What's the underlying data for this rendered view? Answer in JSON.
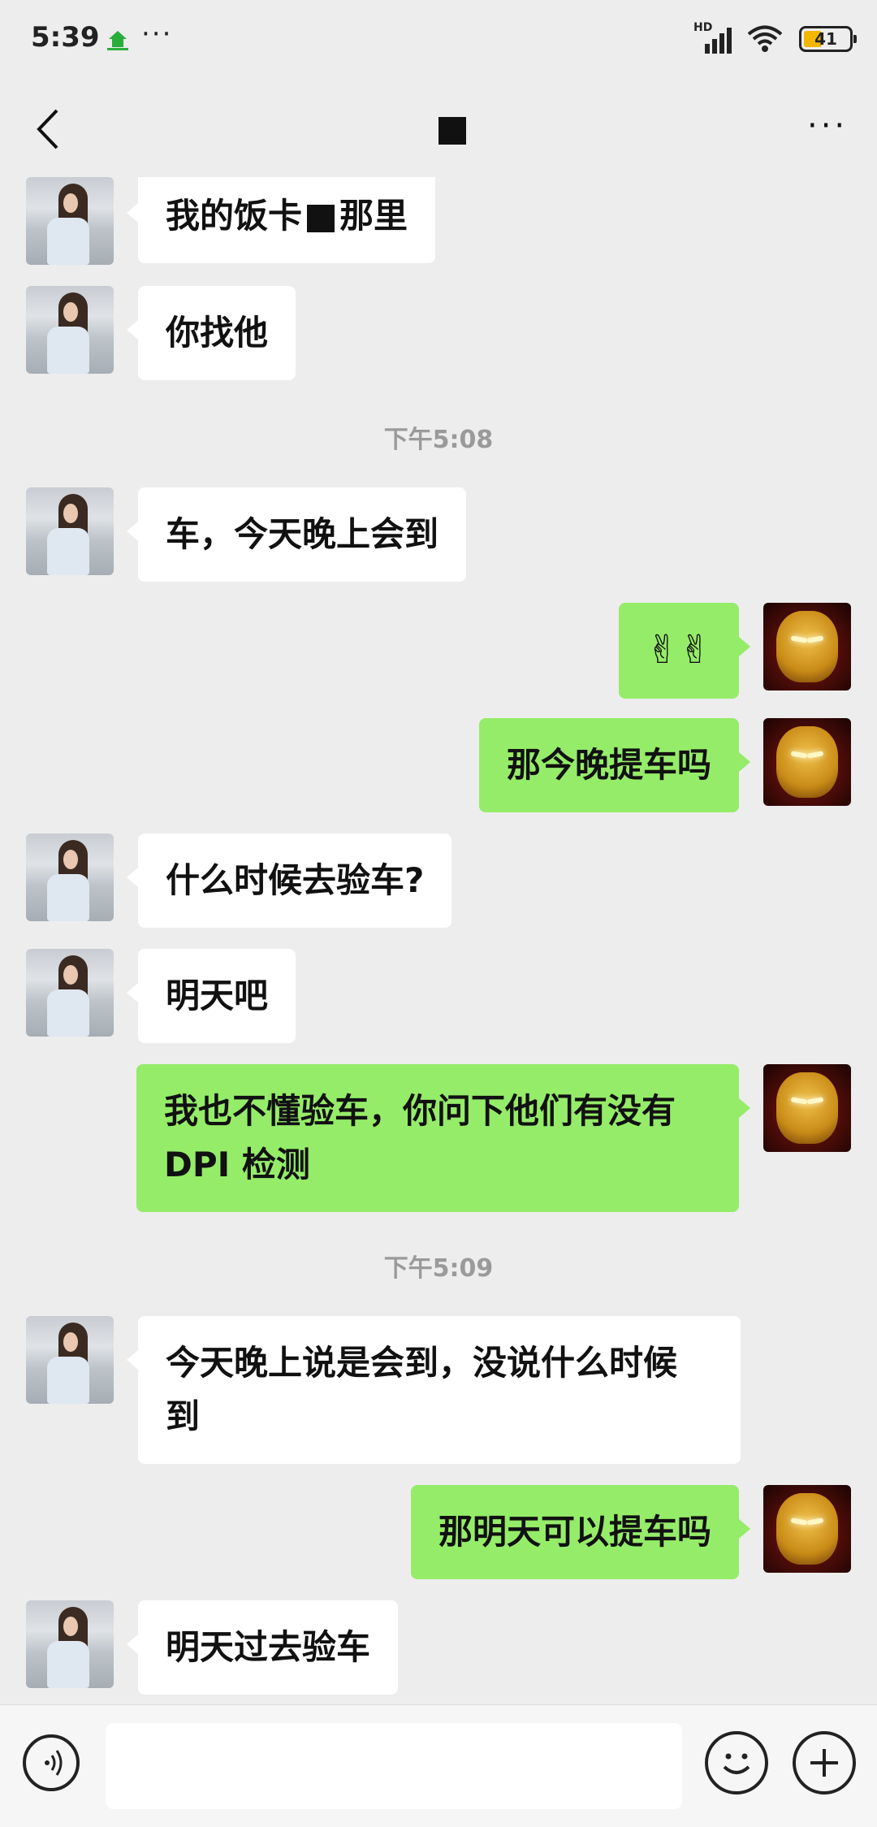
{
  "status_bar": {
    "time": "5:39",
    "dots": "···",
    "network_label": "HD",
    "battery": "41",
    "battery_level_percent": 41,
    "icons": [
      "app-icon",
      "signal-icon",
      "wifi-icon",
      "battery-icon"
    ]
  },
  "nav": {
    "back_icon": "back-chevron-icon",
    "more_icon": "more-icon",
    "more_label": "···"
  },
  "messages": [
    {
      "side": "left",
      "parts": [
        "我的饭卡",
        "[redacted]",
        "那里"
      ]
    },
    {
      "side": "left",
      "text": "你找他"
    },
    {
      "type": "time",
      "text": "下午5:08"
    },
    {
      "side": "left",
      "text": "车，今天晚上会到"
    },
    {
      "side": "right",
      "text": "✌✌"
    },
    {
      "side": "right",
      "text": "那今晚提车吗"
    },
    {
      "side": "left",
      "text": "什么时候去验车?"
    },
    {
      "side": "left",
      "text": "明天吧"
    },
    {
      "side": "right",
      "line1": "我也不懂验车，你问下他们有没有",
      "line2": "DPI 检测"
    },
    {
      "type": "time",
      "text": "下午5:09"
    },
    {
      "side": "left",
      "line1": "今天晚上说是会到，没说什么时候",
      "line2": "到"
    },
    {
      "side": "right",
      "text": "那明天可以提车吗"
    },
    {
      "side": "left",
      "text": "明天过去验车"
    }
  ],
  "input_bar": {
    "voice_icon": "voice-icon",
    "input_value": "",
    "emoji_icon": "emoji-icon",
    "plus_icon": "plus-icon"
  },
  "colors": {
    "background": "#ededed",
    "bubble_self": "#95ec69",
    "bubble_other": "#ffffff",
    "battery_fill": "#f2b600"
  }
}
